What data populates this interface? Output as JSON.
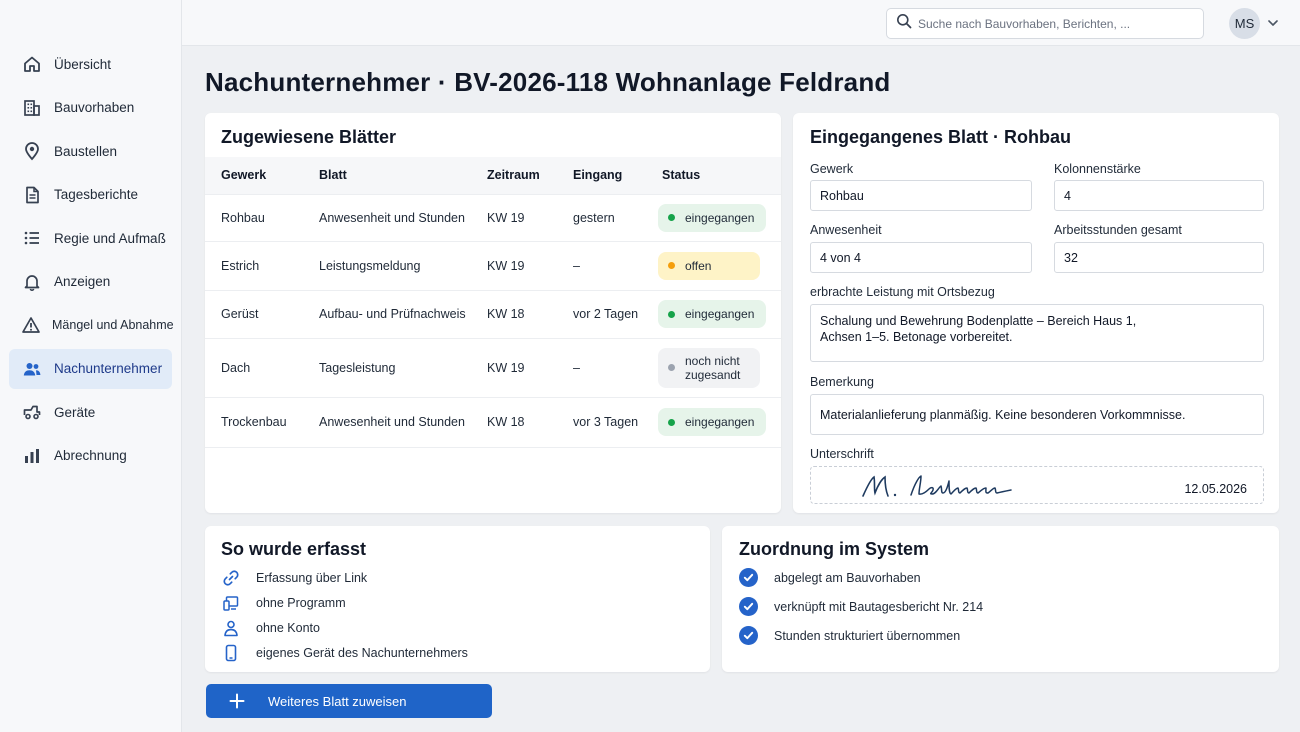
{
  "sidebar": {
    "items": [
      {
        "label": "Übersicht",
        "icon": "home-icon"
      },
      {
        "label": "Bauvorhaben",
        "icon": "building-icon"
      },
      {
        "label": "Baustellen",
        "icon": "map-pin-icon"
      },
      {
        "label": "Tagesberichte",
        "icon": "document-icon"
      },
      {
        "label": "Regie und Aufmaß",
        "icon": "list-icon"
      },
      {
        "label": "Anzeigen",
        "icon": "bell-icon"
      },
      {
        "label": "Mängel und Abnahme",
        "icon": "warning-icon"
      },
      {
        "label": "Nachunternehmer",
        "icon": "users-icon",
        "active": true
      },
      {
        "label": "Geräte",
        "icon": "vehicle-icon"
      },
      {
        "label": "Abrechnung",
        "icon": "bar-chart-icon"
      }
    ]
  },
  "topbar": {
    "search_placeholder": "Suche nach Bauvorhaben, Berichten, ...",
    "avatar_initials": "MS"
  },
  "page": {
    "title": "Nachunternehmer · BV-2026-118 Wohnanlage Feldrand"
  },
  "assigned": {
    "title": "Zugewiesene Blätter",
    "columns": [
      "Gewerk",
      "Blatt",
      "Zeitraum",
      "Eingang",
      "Status"
    ],
    "rows": [
      {
        "gewerk": "Rohbau",
        "blatt": "Anwesenheit und Stunden",
        "zeitraum": "KW 19",
        "eingang": "gestern",
        "status": "eingegangen",
        "status_color": "#16a34a"
      },
      {
        "gewerk": "Estrich",
        "blatt": "Leistungsmeldung",
        "zeitraum": "KW 19",
        "eingang": "–",
        "status": "offen",
        "status_color": "#f59e0b"
      },
      {
        "gewerk": "Gerüst",
        "blatt": "Aufbau- und Prüfnachweis",
        "zeitraum": "KW 18",
        "eingang": "vor 2 Tagen",
        "status": "eingegangen",
        "status_color": "#16a34a"
      },
      {
        "gewerk": "Dach",
        "blatt": "Tagesleistung",
        "zeitraum": "KW 19",
        "eingang": "–",
        "status": "noch nicht\nzugesandt",
        "status_color": "#9ca3af"
      },
      {
        "gewerk": "Trockenbau",
        "blatt": "Anwesenheit und Stunden",
        "zeitraum": "KW 18",
        "eingang": "vor 3 Tagen",
        "status": "eingegangen",
        "status_color": "#16a34a"
      }
    ]
  },
  "received": {
    "title": "Eingegangenes Blatt · Rohbau",
    "gewerk_label": "Gewerk",
    "gewerk_value": "Rohbau",
    "kolonne_label": "Kolonnenstärke",
    "kolonne_value": "4",
    "anwesenheit_label": "Anwesenheit",
    "anwesenheit_value": "4 von 4",
    "stunden_label": "Arbeitsstunden gesamt",
    "stunden_value": "32",
    "leistung_label": "erbrachte Leistung mit Ortsbezug",
    "leistung_value": "Schalung und Bewehrung Bodenplatte – Bereich Haus 1,\nAchsen 1–5. Betonage vorbereitet.",
    "bemerkung_label": "Bemerkung",
    "bemerkung_value": "Materialanlieferung planmäßig. Keine besonderen Vorkommnisse.",
    "unterschrift_label": "Unterschrift",
    "signature_name": "M. Lehmann",
    "signature_date": "12.05.2026"
  },
  "capture": {
    "title": "So wurde erfasst",
    "items": [
      {
        "label": "Erfassung über Link",
        "icon": "link-icon"
      },
      {
        "label": "ohne Programm",
        "icon": "devices-icon"
      },
      {
        "label": "ohne Konto",
        "icon": "person-icon"
      },
      {
        "label": "eigenes Gerät des Nachunternehmers",
        "icon": "smartphone-icon"
      }
    ]
  },
  "assignment": {
    "title": "Zuordnung im System",
    "items": [
      {
        "label": "abgelegt am Bauvorhaben"
      },
      {
        "label": "verknüpft mit Bautagesbericht Nr. 214"
      },
      {
        "label": "Stunden strukturiert übernommen"
      }
    ]
  },
  "actions": {
    "assign_label": "Weiteres Blatt zuweisen"
  },
  "colors": {
    "accent": "#1f64c8",
    "active_nav_bg": "#e1ebf8",
    "success": "#16a34a",
    "pending": "#f59e0b",
    "neutral": "#9ca3af"
  }
}
